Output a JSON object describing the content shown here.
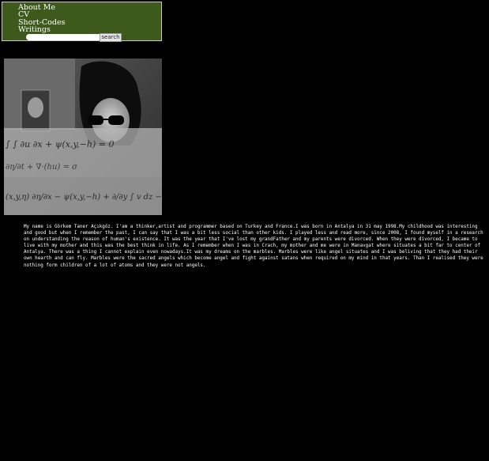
{
  "nav": {
    "items": [
      {
        "label": "About Me"
      },
      {
        "label": "CV"
      },
      {
        "label": "Short-Codes"
      },
      {
        "label": "Writings"
      }
    ],
    "search": {
      "value": "",
      "button_label": "search"
    }
  },
  "photo": {
    "icon": "portrait-photo-with-formula-overlay"
  },
  "bio": {
    "text": "My name is Görkem Taner Açıkgöz. I'am a thinker,artist and programmer based on Turkey and France.I was born in Antalya in 31 may 1998.My childhood was interesting and good but when I remember the past, I can say that I was a bit less social than other kids. I played less and read more, since 2008, I found myself in a research on understanding the reason of human's existence. It was the year that I've lost my grandFather and my parents were divorced. When they were divorced, I became to live with my mother and this was the best think in life. As I remember when I was in Crach, my mother and me were in Manavgat where situates a bit far to center of Antalya. There was a thing I cannot explain even nowadays.It was my dreams on the marbles. Marbles were like angel situates and I was beliving that they had their own hearth and can fly. Marbles were the sacred angels which become angel and fight against satans when required on my mind in that years. Than I realised they were nothing form children of a lot of atoms and they were not angels."
  },
  "colors": {
    "page_background": "#000000",
    "nav_background": "#3d5a1c",
    "nav_border": "#c9c9c9",
    "text": "#ffffff"
  }
}
